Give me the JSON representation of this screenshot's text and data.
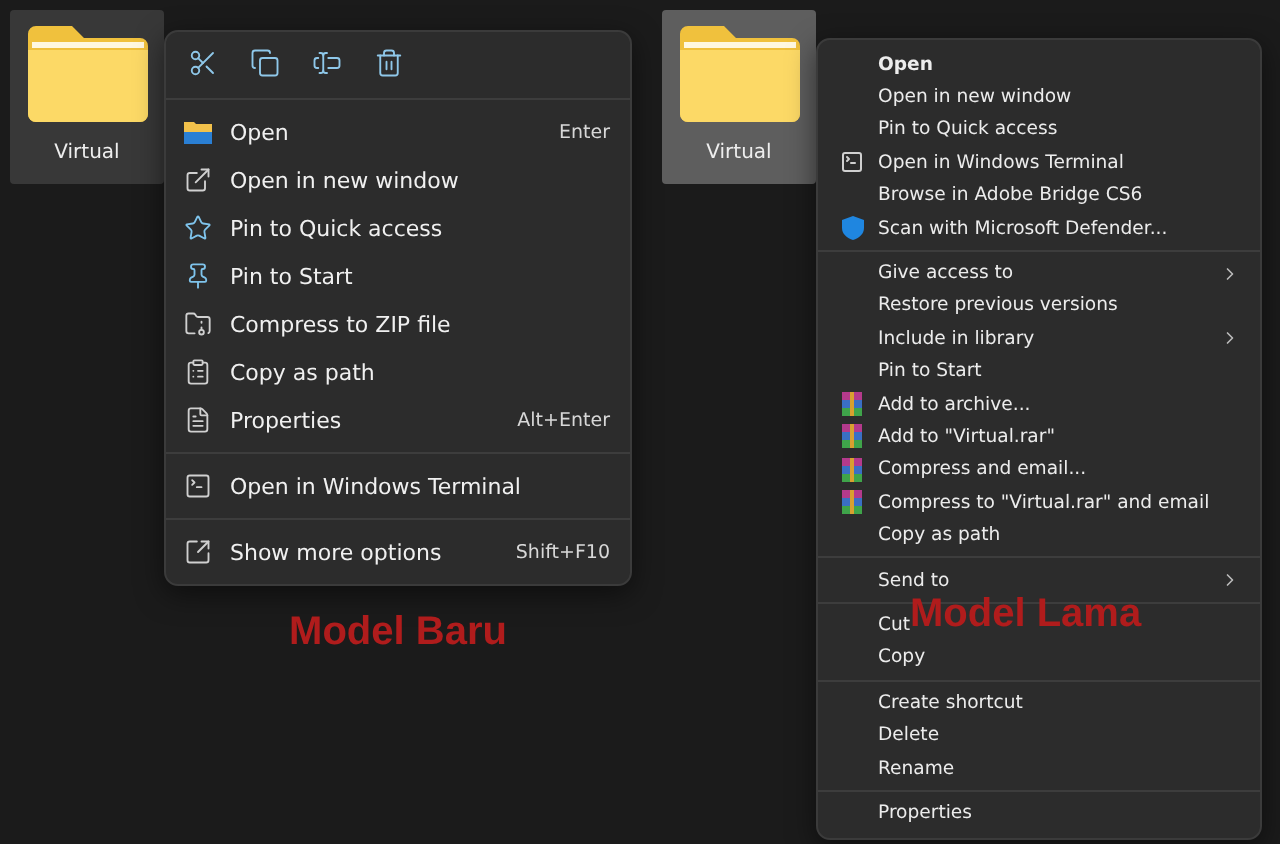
{
  "new_model": {
    "folder": {
      "label": "Virtual",
      "selected": false
    },
    "menu": {
      "toolbar": [
        {
          "kind": "cut"
        },
        {
          "kind": "copy"
        },
        {
          "kind": "rename"
        },
        {
          "kind": "delete"
        }
      ],
      "groups": [
        [
          {
            "kind": "open",
            "label": "Open",
            "shortcut": "Enter"
          },
          {
            "kind": "new-window",
            "label": "Open in new window"
          },
          {
            "kind": "star",
            "label": "Pin to Quick access"
          },
          {
            "kind": "pin",
            "label": "Pin to Start"
          },
          {
            "kind": "zip",
            "label": "Compress to ZIP file"
          },
          {
            "kind": "path",
            "label": "Copy as path"
          },
          {
            "kind": "properties",
            "label": "Properties",
            "shortcut": "Alt+Enter"
          }
        ],
        [
          {
            "kind": "terminal",
            "label": "Open in Windows Terminal"
          }
        ],
        [
          {
            "kind": "more",
            "label": "Show more options",
            "shortcut": "Shift+F10"
          }
        ]
      ]
    },
    "caption": "Model Baru"
  },
  "old_model": {
    "folder": {
      "label": "Virtual",
      "selected": true
    },
    "menu": {
      "groups": [
        [
          {
            "kind": "plain",
            "label": "Open",
            "bold": true
          },
          {
            "kind": "plain",
            "label": "Open in new window"
          },
          {
            "kind": "plain",
            "label": "Pin to Quick access"
          },
          {
            "kind": "terminal",
            "label": "Open in Windows Terminal"
          },
          {
            "kind": "plain",
            "label": "Browse in Adobe Bridge CS6"
          },
          {
            "kind": "shield",
            "label": "Scan with Microsoft Defender..."
          }
        ],
        [
          {
            "kind": "plain",
            "label": "Give access to",
            "submenu": true
          },
          {
            "kind": "plain",
            "label": "Restore previous versions"
          },
          {
            "kind": "plain",
            "label": "Include in library",
            "submenu": true
          },
          {
            "kind": "plain",
            "label": "Pin to Start"
          },
          {
            "kind": "archive",
            "label": "Add to archive..."
          },
          {
            "kind": "archive",
            "label": "Add to \"Virtual.rar\""
          },
          {
            "kind": "archive",
            "label": "Compress and email..."
          },
          {
            "kind": "archive",
            "label": "Compress to \"Virtual.rar\" and email"
          },
          {
            "kind": "plain",
            "label": "Copy as path"
          }
        ],
        [
          {
            "kind": "plain",
            "label": "Send to",
            "submenu": true
          }
        ],
        [
          {
            "kind": "plain",
            "label": "Cut"
          },
          {
            "kind": "plain",
            "label": "Copy"
          }
        ],
        [
          {
            "kind": "plain",
            "label": "Create shortcut"
          },
          {
            "kind": "plain",
            "label": "Delete"
          },
          {
            "kind": "plain",
            "label": "Rename"
          }
        ],
        [
          {
            "kind": "plain",
            "label": "Properties"
          }
        ]
      ]
    },
    "caption": "Model Lama"
  }
}
